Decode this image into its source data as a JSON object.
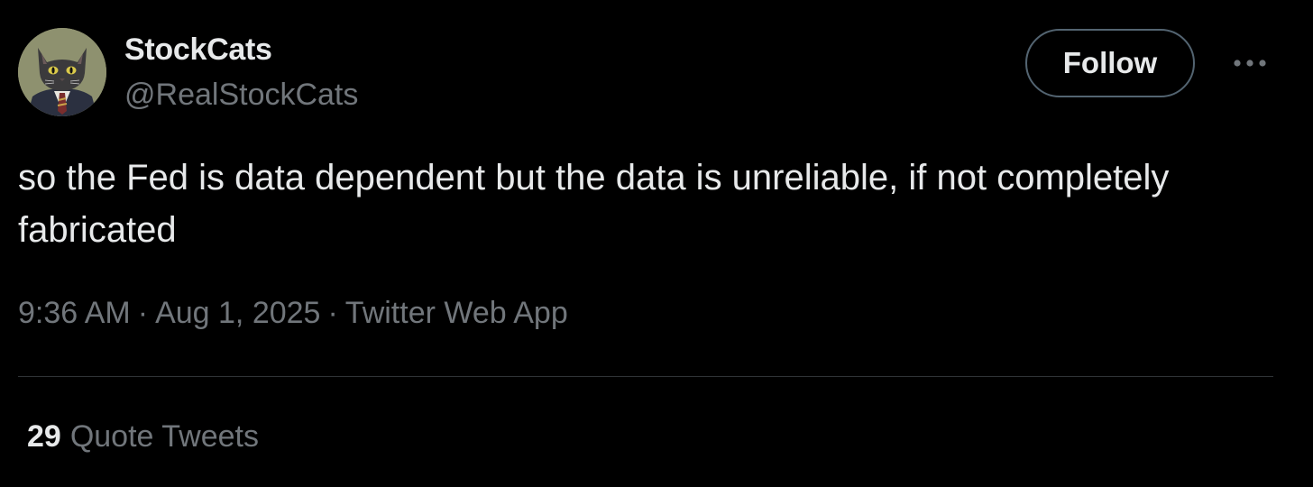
{
  "author": {
    "display_name": "StockCats",
    "handle": "@RealStockCats",
    "avatar_icon": "cat-in-suit-avatar"
  },
  "actions": {
    "follow_label": "Follow",
    "more_icon": "more-horizontal-icon"
  },
  "tweet": {
    "text": "so the Fed is data dependent but the data is unreliable, if not completely fabricated",
    "time": "9:36 AM",
    "date": "Aug 1, 2025",
    "separator": "·",
    "source": "Twitter Web App"
  },
  "stats": {
    "quote_count": "29",
    "quote_label": "Quote Tweets"
  },
  "colors": {
    "background": "#000000",
    "primary_text": "#e7e9ea",
    "secondary_text": "#71767b",
    "border": "#2f3336",
    "button_border": "#536471"
  }
}
